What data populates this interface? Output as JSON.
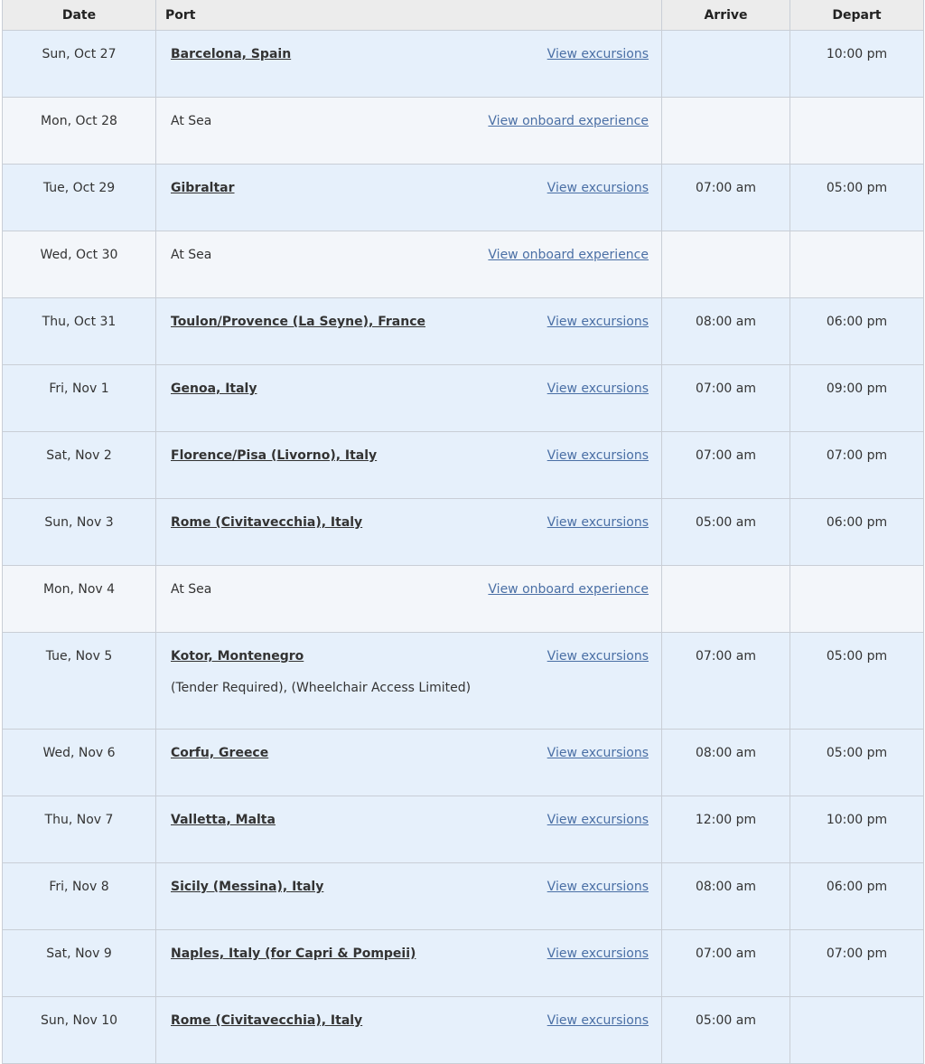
{
  "headers": {
    "date": "Date",
    "port": "Port",
    "arrive": "Arrive",
    "depart": "Depart"
  },
  "rows": [
    {
      "date": "Sun, Oct 27",
      "port": "Barcelona, Spain",
      "link": "View excursions",
      "arrive": "",
      "depart": "10:00 pm"
    },
    {
      "date": "Mon, Oct 28",
      "port": "At Sea",
      "link": "View onboard experience",
      "arrive": "",
      "depart": ""
    },
    {
      "date": "Tue, Oct 29",
      "port": "Gibraltar",
      "link": "View excursions",
      "arrive": "07:00 am",
      "depart": "05:00 pm"
    },
    {
      "date": "Wed, Oct 30",
      "port": "At Sea",
      "link": "View onboard experience",
      "arrive": "",
      "depart": ""
    },
    {
      "date": "Thu, Oct 31",
      "port": "Toulon/Provence (La Seyne), France",
      "link": "View excursions",
      "arrive": "08:00 am",
      "depart": "06:00 pm"
    },
    {
      "date": "Fri, Nov 1",
      "port": "Genoa, Italy",
      "link": "View excursions",
      "arrive": "07:00 am",
      "depart": "09:00 pm"
    },
    {
      "date": "Sat, Nov 2",
      "port": "Florence/Pisa (Livorno), Italy",
      "link": "View excursions",
      "arrive": "07:00 am",
      "depart": "07:00 pm"
    },
    {
      "date": "Sun, Nov 3",
      "port": "Rome (Civitavecchia), Italy",
      "link": "View excursions",
      "arrive": "05:00 am",
      "depart": "06:00 pm"
    },
    {
      "date": "Mon, Nov 4",
      "port": "At Sea",
      "link": "View onboard experience",
      "arrive": "",
      "depart": ""
    },
    {
      "date": "Tue, Nov 5",
      "port": "Kotor, Montenegro",
      "link": "View excursions",
      "arrive": "07:00 am",
      "depart": "05:00 pm",
      "note": "(Tender Required), (Wheelchair Access Limited)"
    },
    {
      "date": "Wed, Nov 6",
      "port": "Corfu, Greece",
      "link": "View excursions",
      "arrive": "08:00 am",
      "depart": "05:00 pm"
    },
    {
      "date": "Thu, Nov 7",
      "port": "Valletta, Malta",
      "link": "View excursions",
      "arrive": "12:00 pm",
      "depart": "10:00 pm"
    },
    {
      "date": "Fri, Nov 8",
      "port": "Sicily (Messina), Italy",
      "link": "View excursions",
      "arrive": "08:00 am",
      "depart": "06:00 pm"
    },
    {
      "date": "Sat, Nov 9",
      "port": "Naples, Italy (for Capri & Pompeii)",
      "link": "View excursions",
      "arrive": "07:00 am",
      "depart": "07:00 pm"
    },
    {
      "date": "Sun, Nov 10",
      "port": "Rome (Civitavecchia), Italy",
      "link": "View excursions",
      "arrive": "05:00 am",
      "depart": ""
    }
  ]
}
